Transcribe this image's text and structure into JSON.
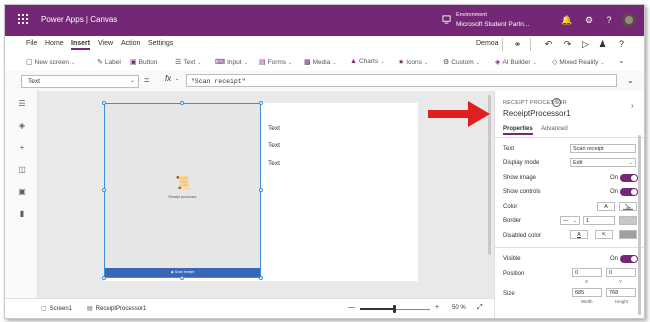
{
  "topbar": {
    "title": "Power Apps  |  Canvas",
    "environment_caption": "Environment",
    "environment_name": "Microsoft Student Partn..."
  },
  "menu": {
    "items": [
      "File",
      "Home",
      "Insert",
      "View",
      "Action",
      "Settings"
    ],
    "active": "Insert",
    "user": "Demoa"
  },
  "ribbon": {
    "items": [
      {
        "label": "New screen",
        "icon": "new-screen-icon",
        "caret": true
      },
      {
        "label": "Label",
        "icon": "label-icon",
        "caret": false
      },
      {
        "label": "Button",
        "icon": "button-icon",
        "caret": false
      },
      {
        "label": "Text",
        "icon": "text-icon",
        "caret": true
      },
      {
        "label": "Input",
        "icon": "input-icon",
        "caret": true
      },
      {
        "label": "Forms",
        "icon": "forms-icon",
        "caret": true
      },
      {
        "label": "Media",
        "icon": "media-icon",
        "caret": true
      },
      {
        "label": "Charts",
        "icon": "charts-icon",
        "caret": true
      },
      {
        "label": "Icons",
        "icon": "icons-icon",
        "caret": true
      },
      {
        "label": "Custom",
        "icon": "custom-icon",
        "caret": true
      },
      {
        "label": "AI Builder",
        "icon": "ai-builder-icon",
        "caret": true
      },
      {
        "label": "Mixed Reality",
        "icon": "mixed-reality-icon",
        "caret": true
      }
    ]
  },
  "formula": {
    "property": "Text",
    "equals": "=",
    "fx": "fx",
    "value": "\"Scan receipt\""
  },
  "canvas": {
    "receipt_processor_label": "Receipt processor",
    "scan_button_label": "Scan receipt",
    "texts": [
      "Text",
      "Text",
      "Text"
    ]
  },
  "panel": {
    "caption": "RECEIPT PROCESSOR",
    "control_name": "ReceiptProcessor1",
    "tabs": [
      "Properties",
      "Advanced"
    ],
    "active_tab": "Properties",
    "props": {
      "text_label": "Text",
      "text_value": "Scan receipt",
      "display_mode_label": "Display mode",
      "display_mode_value": "Edit",
      "show_image_label": "Show image",
      "show_image_value": "On",
      "show_controls_label": "Show controls",
      "show_controls_value": "On",
      "color_label": "Color",
      "color_value": "A",
      "border_label": "Border",
      "border_value": "1",
      "disabled_color_label": "Disabled color",
      "disabled_color_value": "A",
      "visible_label": "Visible",
      "visible_value": "On",
      "position_label": "Position",
      "position_x": "0",
      "position_y": "0",
      "position_x_caption": "X",
      "position_y_caption": "Y",
      "size_label": "Size",
      "size_width": "685",
      "size_height": "768",
      "size_width_caption": "Width",
      "size_height_caption": "Height"
    }
  },
  "status": {
    "screen_tab": "Screen1",
    "control_tab": "ReceiptProcessor1",
    "zoom_minus": "—",
    "zoom_plus": "+",
    "zoom_value": "50  %",
    "zoom_level": 0.5
  },
  "colors": {
    "brand": "#742774",
    "selection": "#3c8fd8",
    "scan_button": "#3867b5",
    "annotation_arrow": "#e02020"
  }
}
